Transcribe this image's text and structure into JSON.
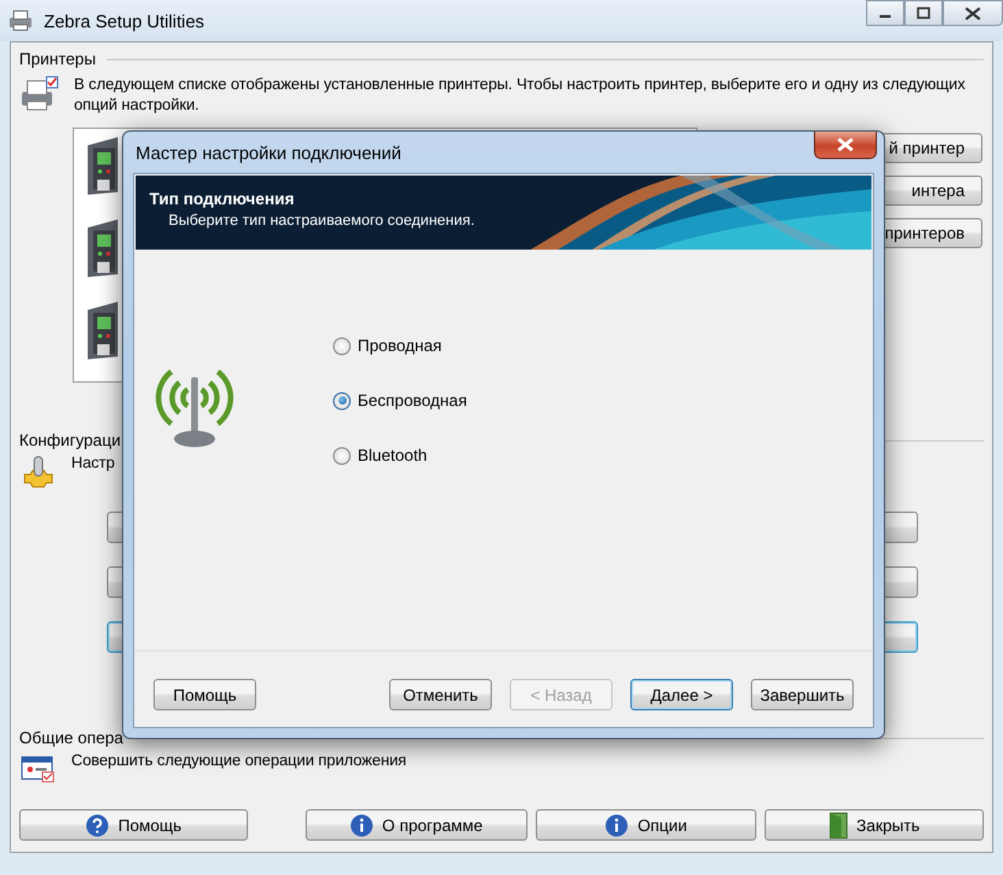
{
  "window": {
    "title": "Zebra Setup Utilities"
  },
  "printers_section": {
    "title": "Принтеры",
    "description": "В следующем списке отображены установленные принтеры. Чтобы настроить принтер, выберите его и одну из следующих опций настройки."
  },
  "side_buttons": [
    "й принтер",
    "интера",
    "принтеров"
  ],
  "config_section": {
    "title": "Конфигураци",
    "description": "Настр",
    "buttons": [
      {
        "focused": false
      },
      {
        "focused": false
      },
      {
        "focused": true
      }
    ]
  },
  "operations_section": {
    "title": "Общие опера",
    "description": "Совершить следующие операции приложения"
  },
  "bottom_buttons": [
    {
      "label": "Помощь",
      "kind": "help"
    },
    {
      "label": "О программе",
      "kind": "info"
    },
    {
      "label": "Опции",
      "kind": "info"
    },
    {
      "label": "Закрыть",
      "kind": "exit"
    }
  ],
  "dialog": {
    "title": "Мастер настройки подключений",
    "heading": "Тип подключения",
    "subheading": "Выберите тип настраиваемого соединения.",
    "options": [
      {
        "label": "Проводная",
        "selected": false
      },
      {
        "label": "Беспроводная",
        "selected": true
      },
      {
        "label": "Bluetooth",
        "selected": false
      }
    ],
    "buttons": [
      {
        "label": "Помощь",
        "disabled": false,
        "default": false
      },
      {
        "label": "Отменить",
        "disabled": false,
        "default": false
      },
      {
        "label": "< Назад",
        "disabled": true,
        "default": false
      },
      {
        "label": "Далее >",
        "disabled": false,
        "default": true
      },
      {
        "label": "Завершить",
        "disabled": false,
        "default": false
      }
    ]
  }
}
